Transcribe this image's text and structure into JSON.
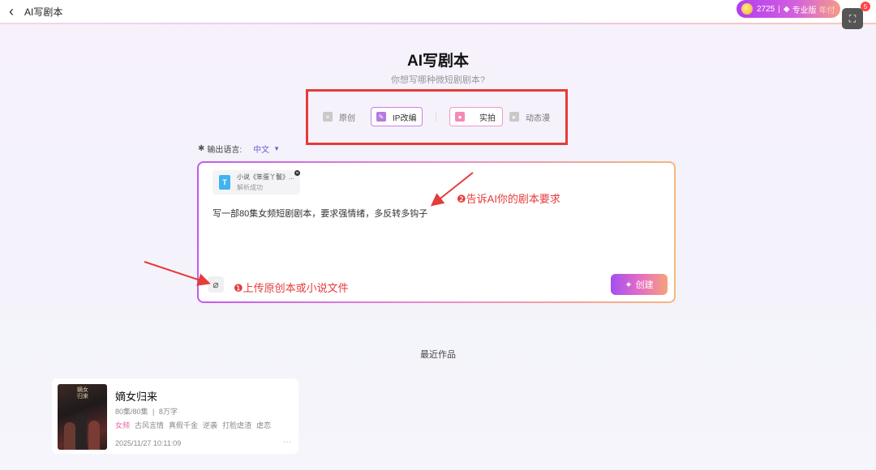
{
  "header": {
    "title": "AI写剧本",
    "points": "2725",
    "separator": "|",
    "plan": "专业版",
    "plan_period": "年付",
    "notification_count": "5"
  },
  "main": {
    "title": "AI写剧本",
    "subtitle": "你想写哪种微短剧剧本?",
    "modes": [
      {
        "label": "原创",
        "selected": false
      },
      {
        "label": "IP改编",
        "selected": true
      },
      {
        "label": "实拍",
        "selected": true
      },
      {
        "label": "动态漫",
        "selected": false
      }
    ],
    "language": {
      "label": "输出语言:",
      "value": "中文"
    },
    "file": {
      "name": "小说《笨蛋丫鬟》...",
      "status": "解析成功"
    },
    "prompt": "写一部80集女频短剧剧本，要求强情绪，多反转多钩子",
    "create_label": "创建"
  },
  "annotations": {
    "step1": "❶上传原创本或小说文件",
    "step2": "❷告诉AI你的剧本要求"
  },
  "recent": {
    "title": "最近作品",
    "works": [
      {
        "title": "嫡女归来",
        "cover_text": "嫡女归来",
        "episodes": "80集/80集",
        "separator": "|",
        "words": "8万字",
        "tags": [
          "女频",
          "古风言情",
          "真假千金",
          "逆袭",
          "打脸虐渣",
          "虐恋"
        ],
        "date": "2025/11/27 10:11:09",
        "more": "···"
      }
    ]
  },
  "colors": {
    "accent": "#6b5fd6",
    "annotation": "#e53b3b",
    "tag_pink": "#e26aa3"
  },
  "icons": [
    "back-arrow-icon",
    "coin-icon",
    "gem-icon",
    "screenshot-icon",
    "bell-icon",
    "doc-icon",
    "pen-icon",
    "camera-icon",
    "animation-icon",
    "translate-icon",
    "file-t-icon",
    "close-icon",
    "paperclip-icon",
    "sparkle-icon"
  ]
}
